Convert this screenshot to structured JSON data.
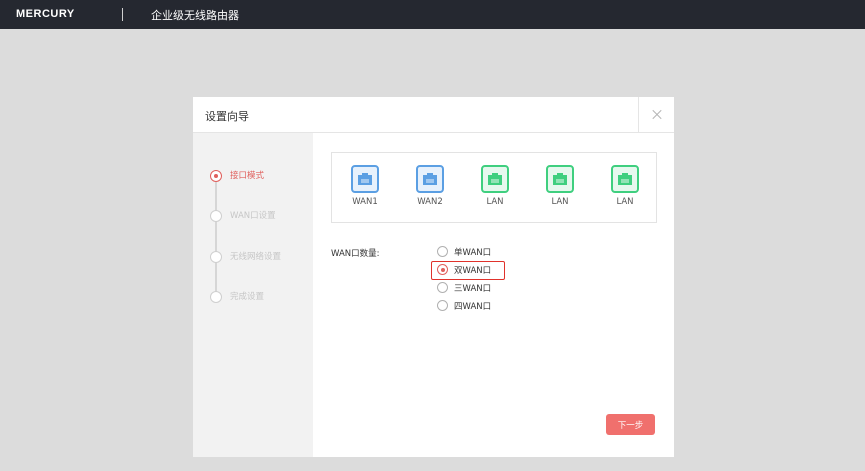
{
  "header": {
    "brand": "MERCURY",
    "product": "企业级无线路由器"
  },
  "dialog": {
    "title": "设置向导",
    "steps": [
      {
        "label": "接口模式",
        "active": true
      },
      {
        "label": "WAN口设置",
        "active": false
      },
      {
        "label": "无线网络设置",
        "active": false
      },
      {
        "label": "完成设置",
        "active": false
      }
    ],
    "ports": [
      {
        "label": "WAN1",
        "type": "wan",
        "icon": "ethernet-port-icon"
      },
      {
        "label": "WAN2",
        "type": "wan",
        "icon": "ethernet-port-icon"
      },
      {
        "label": "LAN",
        "type": "lan",
        "icon": "ethernet-port-icon"
      },
      {
        "label": "LAN",
        "type": "lan",
        "icon": "ethernet-port-icon"
      },
      {
        "label": "LAN",
        "type": "lan",
        "icon": "ethernet-port-icon"
      }
    ],
    "wan_count": {
      "label": "WAN口数量:",
      "options": [
        "单WAN口",
        "双WAN口",
        "三WAN口",
        "四WAN口"
      ],
      "selected": "双WAN口"
    },
    "next_label": "下一步"
  },
  "colors": {
    "accent": "#e0605d",
    "header_bg": "#252830",
    "wan_port": "#5b9fe3",
    "lan_port": "#3fcf7f",
    "highlight": "#e0322b"
  }
}
